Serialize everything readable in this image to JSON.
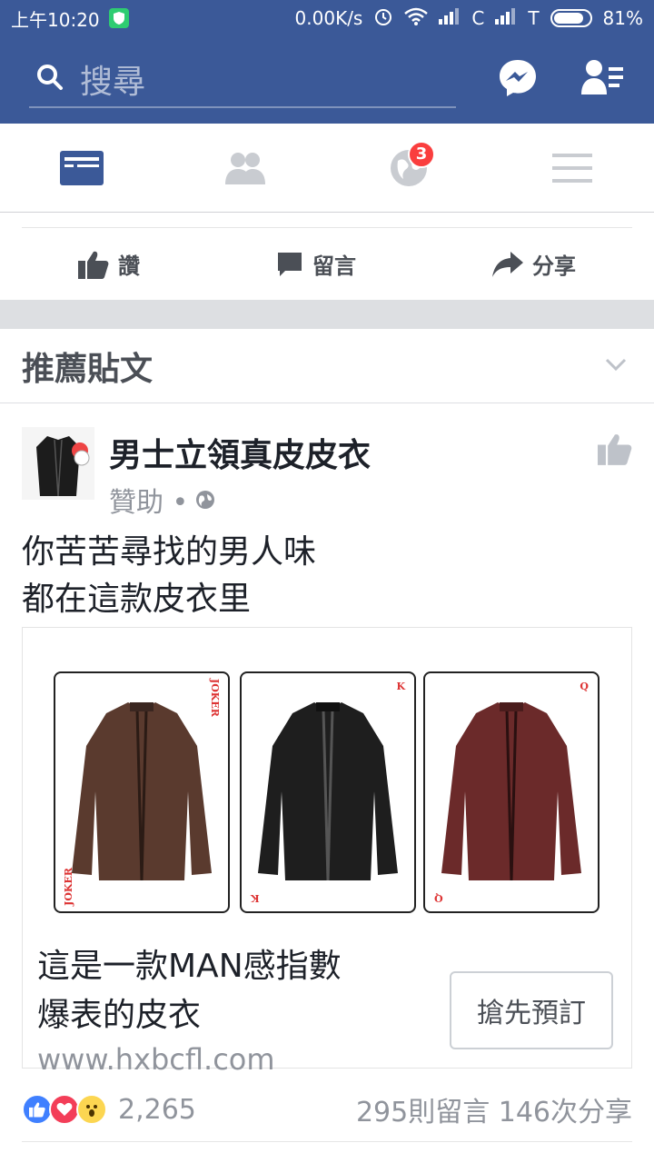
{
  "status": {
    "time": "上午10:20",
    "speed": "0.00K/s",
    "carrier1": "C",
    "carrier2": "T",
    "battery": "81%"
  },
  "search": {
    "placeholder": "搜尋"
  },
  "nav": {
    "notifications_badge": "3"
  },
  "actions": {
    "like": "讚",
    "comment": "留言",
    "share": "分享"
  },
  "section": {
    "title": "推薦貼文"
  },
  "post": {
    "page_name": "男士立領真皮皮衣",
    "sponsored": "贊助 •",
    "text_line1": "你苦苦尋找的男人味",
    "text_line2": "都在這款皮衣里",
    "card": {
      "title_line1": "這是一款MAN感指數",
      "title_line2": "爆表的皮衣",
      "domain": "www.hxbcfl.com",
      "cta": "搶先預訂",
      "playing_cards": [
        {
          "label": "JOKER",
          "color": "#5a3a2e"
        },
        {
          "label": "K",
          "color": "#1e1e1e"
        },
        {
          "label": "Q",
          "color": "#6b2a2a"
        }
      ]
    },
    "reaction_count": "2,265",
    "comments_shares": "295則留言 146次分享"
  },
  "colors": {
    "brand": "#3b5998",
    "badge": "#fa3e3e"
  }
}
